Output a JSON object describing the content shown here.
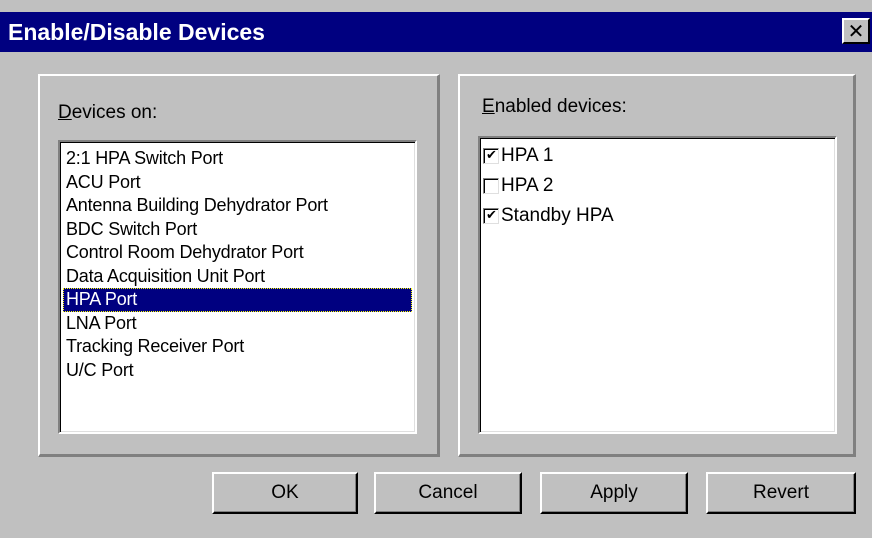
{
  "window": {
    "title": "Enable/Disable Devices",
    "close_glyph": "✕"
  },
  "devices_panel": {
    "label_accel": "D",
    "label_rest": "evices on:",
    "items": [
      "2:1 HPA Switch Port",
      "ACU Port",
      "Antenna Building Dehydrator Port",
      "BDC Switch Port",
      "Control Room Dehydrator Port",
      "Data Acquisition Unit Port",
      "HPA Port",
      "LNA Port",
      "Tracking Receiver Port",
      "U/C Port"
    ],
    "selected": "HPA Port"
  },
  "enabled_panel": {
    "label_accel": "E",
    "label_rest": "nabled devices:",
    "items": [
      {
        "label": "HPA 1",
        "checked": true
      },
      {
        "label": "HPA 2",
        "checked": false
      },
      {
        "label": "Standby HPA",
        "checked": true
      }
    ]
  },
  "buttons": {
    "ok": "OK",
    "cancel": "Cancel",
    "apply": "Apply",
    "revert": "Revert"
  },
  "colors": {
    "titlebar": "#000080",
    "face": "#c0c0c0",
    "selection": "#000080"
  }
}
